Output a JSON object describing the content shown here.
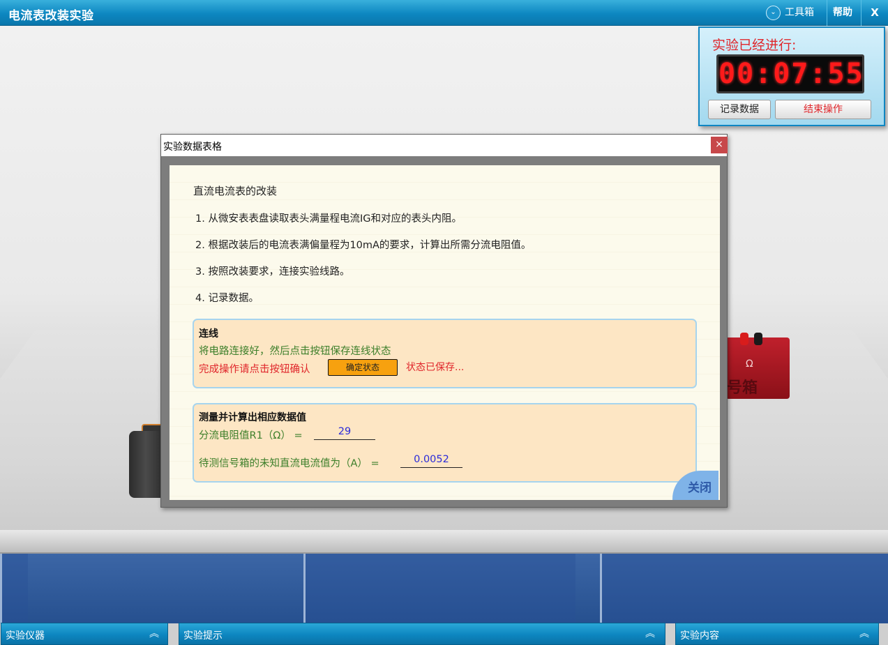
{
  "topbar": {
    "title": "电流表改装实验",
    "toolbox_label": "工具箱",
    "help_label": "帮助",
    "close_label": "X"
  },
  "timer": {
    "label": "实验已经进行:",
    "time": "00:07:55",
    "record_label": "记录数据",
    "end_label": "结束操作"
  },
  "scene": {
    "resistance_box_symbol": "Ω",
    "resistance_box_label": "号箱"
  },
  "dialog": {
    "title": "实验数据表格",
    "close_symbol": "×",
    "heading": "直流电流表的改装",
    "steps": [
      "1. 从微安表表盘读取表头满量程电流IG和对应的表头内阻。",
      "2. 根据改装后的电流表满偏量程为10mA的要求，计算出所需分流电阻值。",
      "3. 按照改装要求，连接实验线路。",
      "4. 记录数据。"
    ],
    "wiring": {
      "title": "连线",
      "instruction": "将电路连接好，然后点击按钮保存连线状态",
      "prompt": "完成操作请点击按钮确认",
      "button_label": "确定状态",
      "status": "状态已保存..."
    },
    "measure": {
      "title": "测量并计算出相应数据值",
      "r1_label": "分流电阻值R1（Ω） =",
      "r1_value": "29",
      "current_label": "待测信号箱的未知直流电流值为（A） =",
      "current_value": "0.0052"
    },
    "close_corner_label": "关闭"
  },
  "bottom": {
    "instruments": "实验仪器",
    "hints": "实验提示",
    "content": "实验内容",
    "arrow": "︽"
  }
}
